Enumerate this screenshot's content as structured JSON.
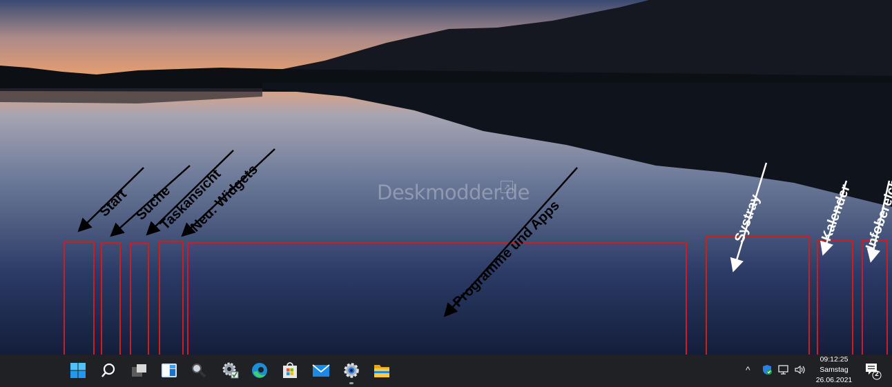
{
  "watermark": "Deskmodder.de",
  "annotations": {
    "start": "Start",
    "suche": "Suche",
    "taskansicht": "Taskansicht",
    "widgets": "Neu: Widgets",
    "programme": "Programme und Apps",
    "systray": "Systray",
    "kalender": "Kalender",
    "infobereich": "Infobereich"
  },
  "taskbar": {
    "icons": [
      "windows-start-icon",
      "search-icon",
      "task-view-icon",
      "widgets-icon",
      "magnifier-icon",
      "control-panel-icon",
      "edge-icon",
      "store-icon",
      "mail-icon",
      "settings-icon",
      "file-explorer-icon"
    ],
    "tray": {
      "icons": [
        "chevron-up-icon",
        "defender-shield-icon",
        "network-icon",
        "volume-icon"
      ],
      "time": "09:12:25",
      "day": "Samstag",
      "date": "26.06.2021",
      "notification_count": "2"
    }
  },
  "colors": {
    "annotation_box": "#d21c1c",
    "taskbar": "#202124",
    "accent": "#1e90ff"
  }
}
